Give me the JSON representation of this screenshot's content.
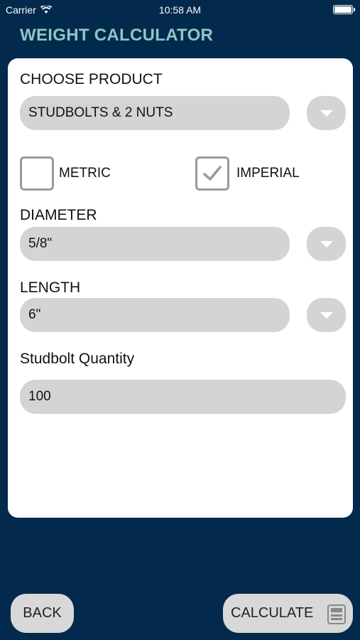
{
  "status_bar": {
    "carrier": "Carrier",
    "time": "10:58 AM"
  },
  "app": {
    "title": "WEIGHT CALCULATOR"
  },
  "form": {
    "product_label": "CHOOSE PRODUCT",
    "product_value": "STUDBOLTS & 2 NUTS",
    "units": {
      "metric_label": "METRIC",
      "metric_checked": false,
      "imperial_label": "IMPERIAL",
      "imperial_checked": true
    },
    "diameter_label": "DIAMETER",
    "diameter_value": "5/8\"",
    "length_label": "LENGTH",
    "length_value": "6\"",
    "quantity_label": "Studbolt Quantity",
    "quantity_value": "100"
  },
  "footer": {
    "back_label": "BACK",
    "calculate_label": "CALCULATE"
  },
  "icons": {
    "wifi": "wifi-icon",
    "battery": "battery-icon",
    "dropdown": "chevron-down-icon",
    "checkmark": "checkmark-icon",
    "calculator": "calculator-icon"
  },
  "colors": {
    "background": "#032a4d",
    "title": "#8fc6c3",
    "card": "#ffffff",
    "field": "#d4d4d4"
  }
}
